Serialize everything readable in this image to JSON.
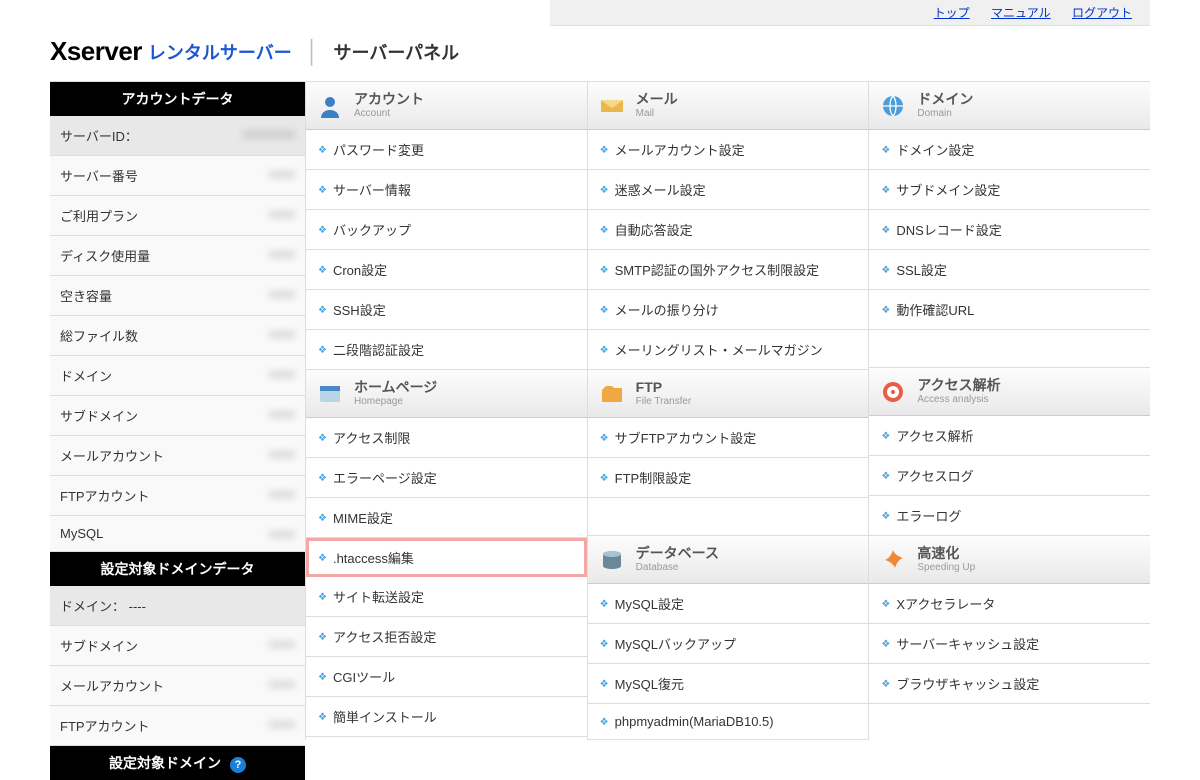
{
  "topbar": {
    "top": "トップ",
    "manual": "マニュアル",
    "logout": "ログアウト"
  },
  "header": {
    "logo": "server",
    "logo_jp": "レンタルサーバー",
    "panel": "サーバーパネル"
  },
  "sidebar": {
    "header1": "アカウントデータ",
    "server_id_label": "サーバーID：",
    "rows": [
      {
        "label": "サーバー番号",
        "value": ""
      },
      {
        "label": "ご利用プラン",
        "value": ""
      },
      {
        "label": "ディスク使用量",
        "value": ""
      },
      {
        "label": "空き容量",
        "value": ""
      },
      {
        "label": "総ファイル数",
        "value": ""
      },
      {
        "label": "ドメイン",
        "value": ""
      },
      {
        "label": "サブドメイン",
        "value": ""
      },
      {
        "label": "メールアカウント",
        "value": ""
      },
      {
        "label": "FTPアカウント",
        "value": ""
      },
      {
        "label": "MySQL",
        "value": ""
      }
    ],
    "header2": "設定対象ドメインデータ",
    "domain_label": "ドメイン： ----",
    "rows2": [
      {
        "label": "サブドメイン",
        "value": ""
      },
      {
        "label": "メールアカウント",
        "value": ""
      },
      {
        "label": "FTPアカウント",
        "value": ""
      }
    ],
    "header3": "設定対象ドメイン"
  },
  "categories": {
    "account": {
      "title": "アカウント",
      "sub": "Account",
      "items": [
        "パスワード変更",
        "サーバー情報",
        "バックアップ",
        "Cron設定",
        "SSH設定",
        "二段階認証設定"
      ]
    },
    "mail": {
      "title": "メール",
      "sub": "Mail",
      "items": [
        "メールアカウント設定",
        "迷惑メール設定",
        "自動応答設定",
        "SMTP認証の国外アクセス制限設定",
        "メールの振り分け",
        "メーリングリスト・メールマガジン"
      ]
    },
    "domain": {
      "title": "ドメイン",
      "sub": "Domain",
      "items": [
        "ドメイン設定",
        "サブドメイン設定",
        "DNSレコード設定",
        "SSL設定",
        "動作確認URL"
      ]
    },
    "homepage": {
      "title": "ホームページ",
      "sub": "Homepage",
      "items": [
        "アクセス制限",
        "エラーページ設定",
        "MIME設定",
        ".htaccess編集",
        "サイト転送設定",
        "アクセス拒否設定",
        "CGIツール",
        "簡単インストール"
      ]
    },
    "ftp": {
      "title": "FTP",
      "sub": "File Transfer",
      "items": [
        "サブFTPアカウント設定",
        "FTP制限設定"
      ]
    },
    "access": {
      "title": "アクセス解析",
      "sub": "Access analysis",
      "items": [
        "アクセス解析",
        "アクセスログ",
        "エラーログ"
      ]
    },
    "database": {
      "title": "データベース",
      "sub": "Database",
      "items": [
        "MySQL設定",
        "MySQLバックアップ",
        "MySQL復元",
        "phpmyadmin(MariaDB10.5)"
      ]
    },
    "speedup": {
      "title": "高速化",
      "sub": "Speeding Up",
      "items": [
        "Xアクセラレータ",
        "サーバーキャッシュ設定",
        "ブラウザキャッシュ設定"
      ]
    }
  },
  "highlighted": ".htaccess編集"
}
